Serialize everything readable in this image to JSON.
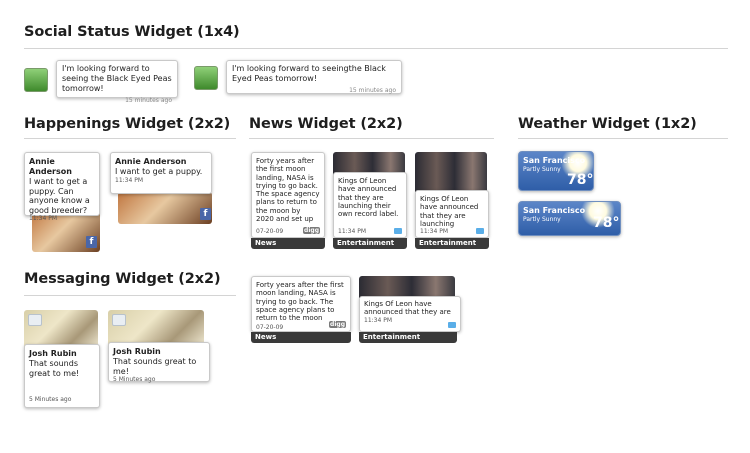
{
  "sections": {
    "social": "Social Status Widget (1x4)",
    "happenings": "Happenings Widget (2x2)",
    "news": "News Widget (2x2)",
    "weather": "Weather Widget (1x2)",
    "messaging": "Messaging Widget (2x2)"
  },
  "social": [
    {
      "text": "I'm looking forward to seeing the Black Eyed Peas tomorrow!",
      "time": "15 minutes ago"
    },
    {
      "text": "I'm looking forward to seeingthe Black Eyed Peas tomorrow!",
      "time": "15 minutes ago"
    }
  ],
  "happenings": [
    {
      "name": "Annie Anderson",
      "text": "I want to get a puppy. Can anyone know a good breeder?",
      "time": "11:34 PM"
    },
    {
      "name": "Annie Anderson",
      "text": "I want to get a puppy.",
      "time": "11:34 PM"
    }
  ],
  "news": [
    {
      "text": "Forty years after the first moon landing, NASA is trying to go back. The space agency plans to return to the moon by 2020 and set up",
      "meta": "07-20-09",
      "label": "News",
      "badge": "digg"
    },
    {
      "text": "Kings Of Leon have announced that they are launching their own record label.",
      "meta": "11:34 PM",
      "label": "Entertainment"
    },
    {
      "text": "Kings Of Leon have announced that they are launching",
      "meta": "11:34 PM",
      "label": "Entertainment"
    },
    {
      "text": "Forty years after the first moon landing, NASA is trying to go back. The space agency plans to return to the moon",
      "meta": "07-20-09",
      "label": "News",
      "badge": "digg"
    },
    {
      "text": "Kings Of Leon have announced that they are",
      "meta": "11:34 PM",
      "label": "Entertainment"
    }
  ],
  "weather": [
    {
      "city": "San Francisco",
      "cond": "Partly Sunny",
      "temp": "78°"
    },
    {
      "city": "San Francisco",
      "cond": "Partly Sunny",
      "temp": "78°"
    }
  ],
  "messaging": [
    {
      "name": "Josh Rubin",
      "text": "That sounds great to me!",
      "time": "5 Minutes ago"
    },
    {
      "name": "Josh Rubin",
      "text": "That sounds great to me!",
      "time": "5 Minutes ago"
    }
  ],
  "icons": {
    "facebook": "f"
  },
  "colors": {
    "weather_bg": "#2f5ea8",
    "label_bar": "#3a3a3a",
    "avatar": "#5ea845"
  }
}
